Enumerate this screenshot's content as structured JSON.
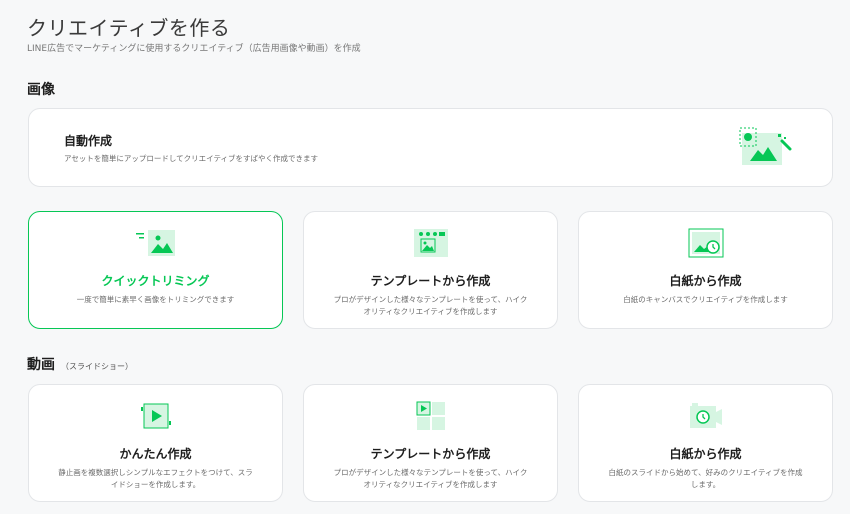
{
  "header": {
    "title": "クリエイティブを作る",
    "subtitle": "LINE広告でマーケティングに使用するクリエイティブ（広告用画像や動画）を作成"
  },
  "sections": {
    "image": {
      "title": "画像",
      "auto": {
        "title": "自動作成",
        "description": "アセットを簡単にアップロードしてクリエイティブをすばやく作成できます"
      },
      "cards": [
        {
          "title": "クイックトリミング",
          "description": "一度で簡単に素早く画像をトリミングできます",
          "selected": true,
          "icon": "image-trim-icon"
        },
        {
          "title": "テンプレートから作成",
          "description": "プロがデザインした様々なテンプレートを使って、ハイクオリティなクリエイティブを作成します",
          "selected": false,
          "icon": "image-template-icon"
        },
        {
          "title": "白紙から作成",
          "description": "白紙のキャンバスでクリエイティブを作成します",
          "selected": false,
          "icon": "blank-canvas-icon"
        }
      ]
    },
    "video": {
      "title": "動画",
      "suffix": "（スライドショー）",
      "cards": [
        {
          "title": "かんたん作成",
          "description": "静止画を複数選択しシンプルなエフェクトをつけて、スライドショーを作成します。",
          "icon": "video-easy-icon"
        },
        {
          "title": "テンプレートから作成",
          "description": "プロがデザインした様々なテンプレートを使って、ハイクオリティなクリエイティブを作成します",
          "icon": "video-template-icon"
        },
        {
          "title": "白紙から作成",
          "description": "白紙のスライドから始めて、好みのクリエイティブを作成します。",
          "icon": "video-blank-icon"
        }
      ]
    }
  },
  "colors": {
    "accent": "#06c755",
    "accent_light": "#d6f5e2",
    "card_border": "#e3e5e8",
    "background": "#f7f8f9"
  }
}
